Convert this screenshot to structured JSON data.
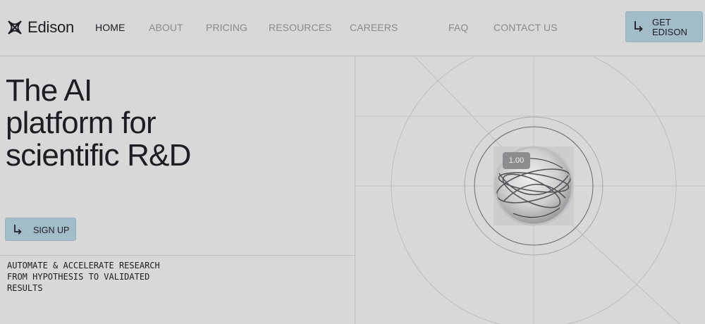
{
  "brand": {
    "name": "Edison",
    "icon": "edison-logo-icon"
  },
  "nav": {
    "items": [
      {
        "label": "HOME",
        "active": true
      },
      {
        "label": "ABOUT",
        "active": false
      },
      {
        "label": "PRICING",
        "active": false
      },
      {
        "label": "RESOURCES",
        "active": false
      },
      {
        "label": "CAREERS",
        "active": false
      },
      {
        "label": "FAQ",
        "active": false
      },
      {
        "label": "CONTACT US",
        "active": false
      }
    ]
  },
  "header_cta": {
    "label": "GET EDISON",
    "icon": "corner-arrow-icon"
  },
  "hero": {
    "title_lines": [
      "The AI",
      "platform  for",
      "scientific R&D"
    ],
    "signup": {
      "label": "SIGN UP",
      "icon": "corner-arrow-icon"
    },
    "tagline_lines": [
      "AUTOMATE & ACCELERATE RESEARCH",
      "FROM HYPOTHESIS TO VALIDATED",
      "RESULTS"
    ]
  },
  "visual": {
    "badge": "1.00",
    "colors": {
      "background": "#d8d8d8",
      "accent": "#a3bcc9"
    }
  }
}
